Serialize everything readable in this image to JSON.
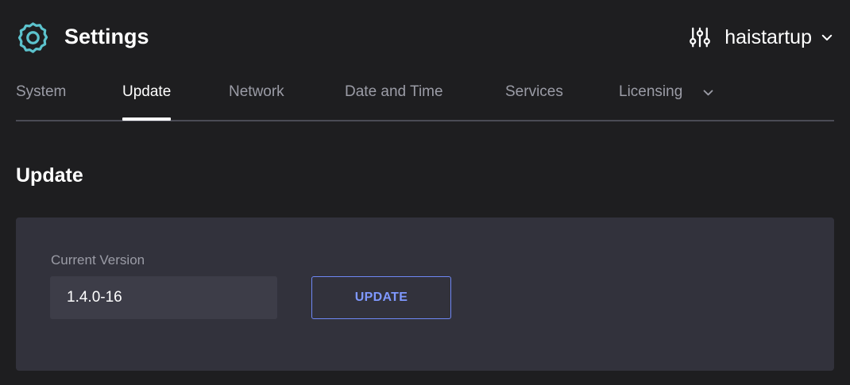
{
  "header": {
    "app_icon": "gear-icon",
    "title": "Settings",
    "org_icon": "sliders-icon",
    "org_name": "haistartup",
    "org_chevron": "chevron-down-icon"
  },
  "tabs": [
    {
      "label": "System",
      "active": false
    },
    {
      "label": "Update",
      "active": true
    },
    {
      "label": "Network",
      "active": false
    },
    {
      "label": "Date and Time",
      "active": false
    },
    {
      "label": "Services",
      "active": false
    },
    {
      "label": "Licensing",
      "active": false,
      "has_dropdown": true
    }
  ],
  "section": {
    "title": "Update"
  },
  "version_panel": {
    "label": "Current Version",
    "value": "1.4.0-16",
    "button_label": "UPDATE"
  },
  "colors": {
    "background": "#1e1e20",
    "panel": "#32323c",
    "input": "#3d3d48",
    "accent_teal": "#5cc3cd",
    "button_blue": "#7f98ff",
    "muted_text": "#9b9ca6"
  }
}
